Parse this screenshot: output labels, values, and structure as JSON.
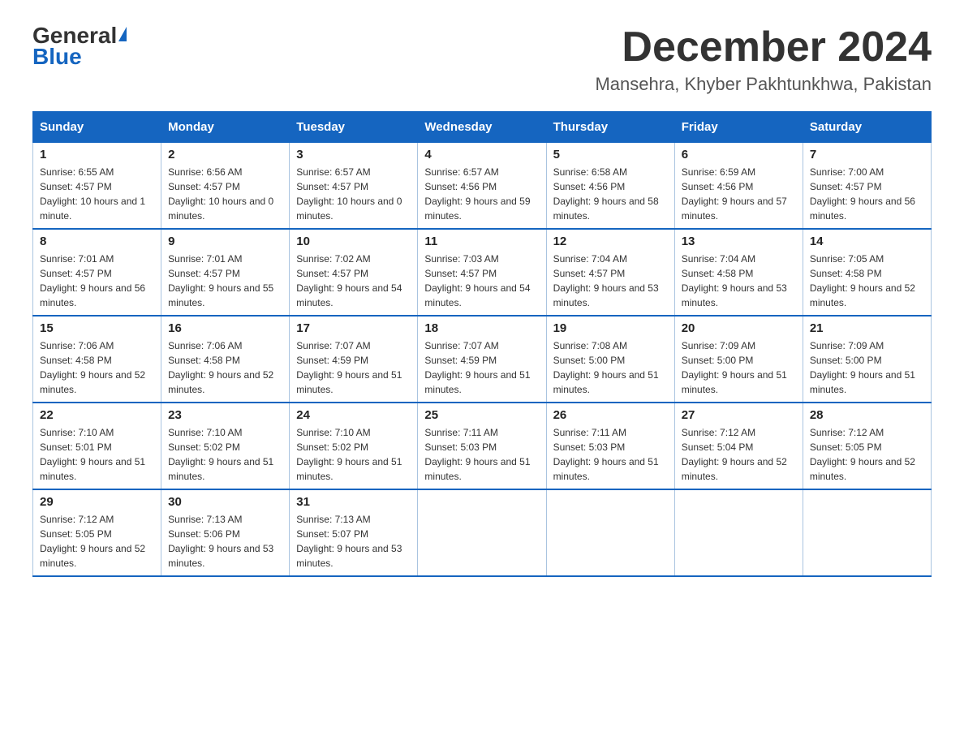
{
  "header": {
    "logo_general": "General",
    "logo_blue": "Blue",
    "month_title": "December 2024",
    "location": "Mansehra, Khyber Pakhtunkhwa, Pakistan"
  },
  "days_of_week": [
    "Sunday",
    "Monday",
    "Tuesday",
    "Wednesday",
    "Thursday",
    "Friday",
    "Saturday"
  ],
  "weeks": [
    [
      {
        "day": "1",
        "sunrise": "6:55 AM",
        "sunset": "4:57 PM",
        "daylight": "10 hours and 1 minute."
      },
      {
        "day": "2",
        "sunrise": "6:56 AM",
        "sunset": "4:57 PM",
        "daylight": "10 hours and 0 minutes."
      },
      {
        "day": "3",
        "sunrise": "6:57 AM",
        "sunset": "4:57 PM",
        "daylight": "10 hours and 0 minutes."
      },
      {
        "day": "4",
        "sunrise": "6:57 AM",
        "sunset": "4:56 PM",
        "daylight": "9 hours and 59 minutes."
      },
      {
        "day": "5",
        "sunrise": "6:58 AM",
        "sunset": "4:56 PM",
        "daylight": "9 hours and 58 minutes."
      },
      {
        "day": "6",
        "sunrise": "6:59 AM",
        "sunset": "4:56 PM",
        "daylight": "9 hours and 57 minutes."
      },
      {
        "day": "7",
        "sunrise": "7:00 AM",
        "sunset": "4:57 PM",
        "daylight": "9 hours and 56 minutes."
      }
    ],
    [
      {
        "day": "8",
        "sunrise": "7:01 AM",
        "sunset": "4:57 PM",
        "daylight": "9 hours and 56 minutes."
      },
      {
        "day": "9",
        "sunrise": "7:01 AM",
        "sunset": "4:57 PM",
        "daylight": "9 hours and 55 minutes."
      },
      {
        "day": "10",
        "sunrise": "7:02 AM",
        "sunset": "4:57 PM",
        "daylight": "9 hours and 54 minutes."
      },
      {
        "day": "11",
        "sunrise": "7:03 AM",
        "sunset": "4:57 PM",
        "daylight": "9 hours and 54 minutes."
      },
      {
        "day": "12",
        "sunrise": "7:04 AM",
        "sunset": "4:57 PM",
        "daylight": "9 hours and 53 minutes."
      },
      {
        "day": "13",
        "sunrise": "7:04 AM",
        "sunset": "4:58 PM",
        "daylight": "9 hours and 53 minutes."
      },
      {
        "day": "14",
        "sunrise": "7:05 AM",
        "sunset": "4:58 PM",
        "daylight": "9 hours and 52 minutes."
      }
    ],
    [
      {
        "day": "15",
        "sunrise": "7:06 AM",
        "sunset": "4:58 PM",
        "daylight": "9 hours and 52 minutes."
      },
      {
        "day": "16",
        "sunrise": "7:06 AM",
        "sunset": "4:58 PM",
        "daylight": "9 hours and 52 minutes."
      },
      {
        "day": "17",
        "sunrise": "7:07 AM",
        "sunset": "4:59 PM",
        "daylight": "9 hours and 51 minutes."
      },
      {
        "day": "18",
        "sunrise": "7:07 AM",
        "sunset": "4:59 PM",
        "daylight": "9 hours and 51 minutes."
      },
      {
        "day": "19",
        "sunrise": "7:08 AM",
        "sunset": "5:00 PM",
        "daylight": "9 hours and 51 minutes."
      },
      {
        "day": "20",
        "sunrise": "7:09 AM",
        "sunset": "5:00 PM",
        "daylight": "9 hours and 51 minutes."
      },
      {
        "day": "21",
        "sunrise": "7:09 AM",
        "sunset": "5:00 PM",
        "daylight": "9 hours and 51 minutes."
      }
    ],
    [
      {
        "day": "22",
        "sunrise": "7:10 AM",
        "sunset": "5:01 PM",
        "daylight": "9 hours and 51 minutes."
      },
      {
        "day": "23",
        "sunrise": "7:10 AM",
        "sunset": "5:02 PM",
        "daylight": "9 hours and 51 minutes."
      },
      {
        "day": "24",
        "sunrise": "7:10 AM",
        "sunset": "5:02 PM",
        "daylight": "9 hours and 51 minutes."
      },
      {
        "day": "25",
        "sunrise": "7:11 AM",
        "sunset": "5:03 PM",
        "daylight": "9 hours and 51 minutes."
      },
      {
        "day": "26",
        "sunrise": "7:11 AM",
        "sunset": "5:03 PM",
        "daylight": "9 hours and 51 minutes."
      },
      {
        "day": "27",
        "sunrise": "7:12 AM",
        "sunset": "5:04 PM",
        "daylight": "9 hours and 52 minutes."
      },
      {
        "day": "28",
        "sunrise": "7:12 AM",
        "sunset": "5:05 PM",
        "daylight": "9 hours and 52 minutes."
      }
    ],
    [
      {
        "day": "29",
        "sunrise": "7:12 AM",
        "sunset": "5:05 PM",
        "daylight": "9 hours and 52 minutes."
      },
      {
        "day": "30",
        "sunrise": "7:13 AM",
        "sunset": "5:06 PM",
        "daylight": "9 hours and 53 minutes."
      },
      {
        "day": "31",
        "sunrise": "7:13 AM",
        "sunset": "5:07 PM",
        "daylight": "9 hours and 53 minutes."
      },
      null,
      null,
      null,
      null
    ]
  ]
}
